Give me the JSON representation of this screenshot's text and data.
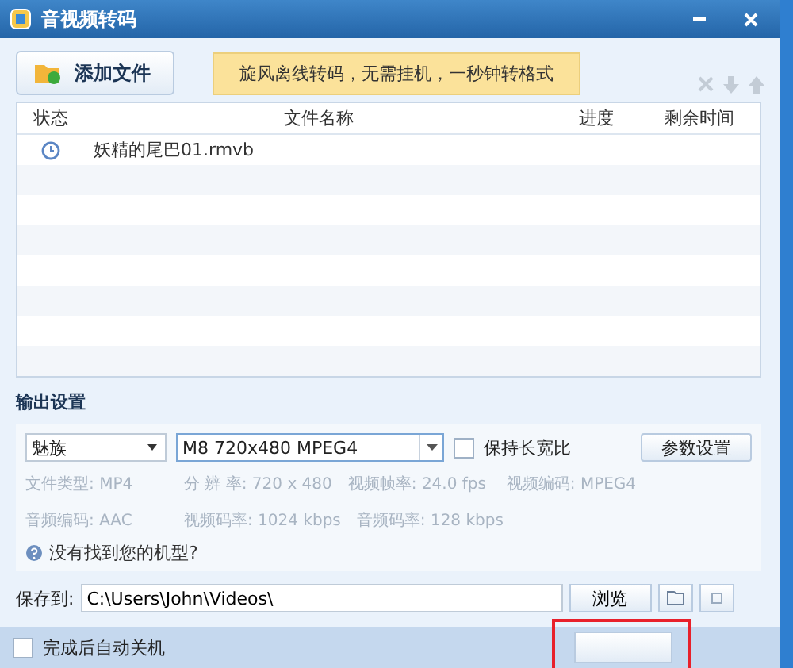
{
  "window": {
    "title": "音视频转码"
  },
  "toolbar": {
    "add_button": "添加文件",
    "banner": "旋风离线转码，无需挂机，一秒钟转格式"
  },
  "table": {
    "columns": [
      "状态",
      "文件名称",
      "进度",
      "剩余时间"
    ],
    "rows": [
      {
        "kind": "waiting",
        "name": "妖精的尾巴01.rmvb"
      }
    ]
  },
  "output": {
    "heading": "输出设置",
    "brand": "魅族",
    "preset": "M8 720x480 MPEG4",
    "keep_ratio": {
      "label": "保持长宽比",
      "checked": false
    },
    "params_button": "参数设置",
    "info_rows": [
      [
        {
          "label": "文件类型:",
          "value": "MP4"
        },
        {
          "label": "分 辨 率:",
          "value": "720 x 480"
        },
        {
          "label": "视频帧率:",
          "value": "24.0 fps"
        },
        {
          "label": "视频编码:",
          "value": "MPEG4"
        }
      ],
      [
        {
          "label": "音频编码:",
          "value": "AAC"
        },
        {
          "label": "视频码率:",
          "value": "1024 kbps"
        },
        {
          "label": "音频码率:",
          "value": "128 kbps"
        }
      ]
    ],
    "help_link": "没有找到您的机型?"
  },
  "save": {
    "label": "保存到:",
    "path": "C:\\Users\\John\\Videos\\",
    "browse": "浏览"
  },
  "footer": {
    "shutdown": {
      "label": "完成后自动关机",
      "checked": false
    }
  }
}
